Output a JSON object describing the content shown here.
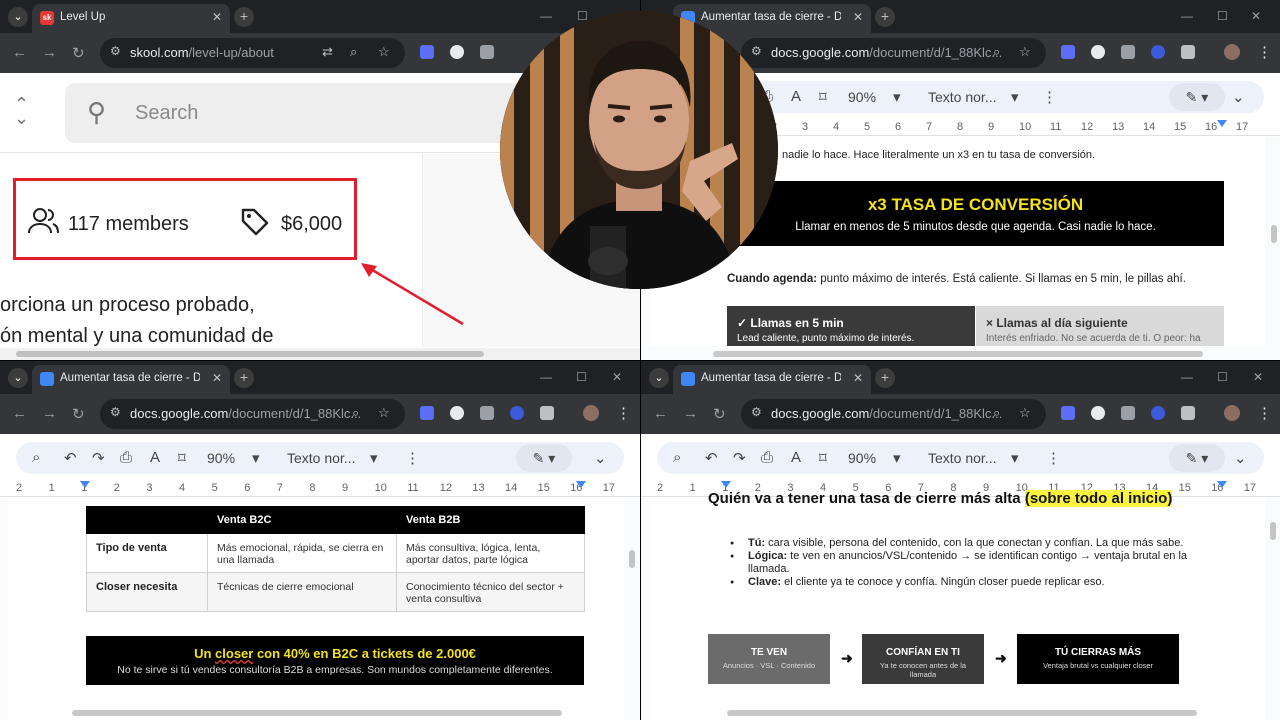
{
  "top_left": {
    "tab_title": "Level Up",
    "favicon": "sk",
    "url_host": "skool.com",
    "url_path": "/level-up/about",
    "search_placeholder": "Search",
    "members": "117 members",
    "price": "$6,000",
    "desc_line1": "orciona un proceso probado,",
    "desc_line2": "ón mental y una comunidad de",
    "highlight_color": "#e11d2e"
  },
  "top_right": {
    "tab_title": "Aumentar tasa de cierre - Docu",
    "url_host": "docs.google.com",
    "url_path": "/document/d/1_88Klc...",
    "zoom": "90%",
    "style": "Texto nor...",
    "line": "nadie lo hace. Hace literalmente un x3 en tu tasa de conversión.",
    "banner_title": "x3 TASA DE CONVERSIÓN",
    "banner_sub": "Llamar en menos de 5 minutos desde que agenda. Casi nadie lo hace.",
    "para_bold": "Cuando agenda:",
    "para_rest": " punto máximo de interés. Está caliente. Si llamas en 5 min, le pillas ahí.",
    "left_head": "✓  Llamas en 5 min",
    "left_sub": "Lead caliente, punto máximo de interés.",
    "right_head": "×  Llamas al día siguiente",
    "right_sub": "Interés enfriado. No se acuerda de ti. O peor: ha"
  },
  "bottom_left": {
    "tab_title": "Aumentar tasa de cierre - Docu",
    "url_host": "docs.google.com",
    "url_path": "/document/d/1_88Klc...",
    "zoom": "90%",
    "style": "Texto nor...",
    "table": {
      "headers": [
        "",
        "Venta B2C",
        "Venta B2B"
      ],
      "rows": [
        [
          "Tipo de venta",
          "Más emocional, rápida, se cierra en una llamada",
          "Más consultiva, lógica, lenta, aportar datos, parte lógica"
        ],
        [
          "Closer necesita",
          "Técnicas de cierre emocional",
          "Conocimiento técnico del sector + venta consultiva"
        ]
      ]
    },
    "banner_pre": "Un ",
    "banner_word": "closer",
    "banner_post": " con 40% en B2C a tickets de 2.000€",
    "banner_sub": "No te sirve si tú vendes consultoría B2B a empresas. Son mundos completamente diferentes."
  },
  "bottom_right": {
    "tab_title": "Aumentar tasa de cierre - Docu",
    "url_host": "docs.google.com",
    "url_path": "/document/d/1_88Klc...",
    "zoom": "90%",
    "style": "Texto nor...",
    "heading": "Quién va a tener una tasa de cierre más alta ",
    "heading_hl": "(sobre todo al inicio)",
    "bullets": [
      {
        "bold": "Tú:",
        "text": " cara visible, persona del contenido, con la que conectan y confían. La que más sabe."
      },
      {
        "bold": "Lógica:",
        "text": " te ven en anuncios/VSL/contenido → se identifican contigo → ventaja brutal en la llamada."
      },
      {
        "bold": "Clave:",
        "text": " el cliente ya te conoce y confía. Ningún closer puede replicar eso."
      }
    ],
    "flow": [
      {
        "title": "TE VEN",
        "desc": "Anuncios · VSL · Contenido",
        "color": "#6b6b6b"
      },
      {
        "title": "CONFÍAN EN TI",
        "desc": "Ya te conocen antes de la llamada",
        "color": "#3a3a3a"
      },
      {
        "title": "TÚ CIERRAS MÁS",
        "desc": "Ventaja brutal vs cualquier closer",
        "color": "#000000"
      }
    ]
  },
  "ruler_numbers": [
    "2",
    "1",
    "1",
    "2",
    "3",
    "4",
    "5",
    "6",
    "7",
    "8",
    "9",
    "10",
    "11",
    "12",
    "13",
    "14",
    "15",
    "16",
    "17"
  ]
}
